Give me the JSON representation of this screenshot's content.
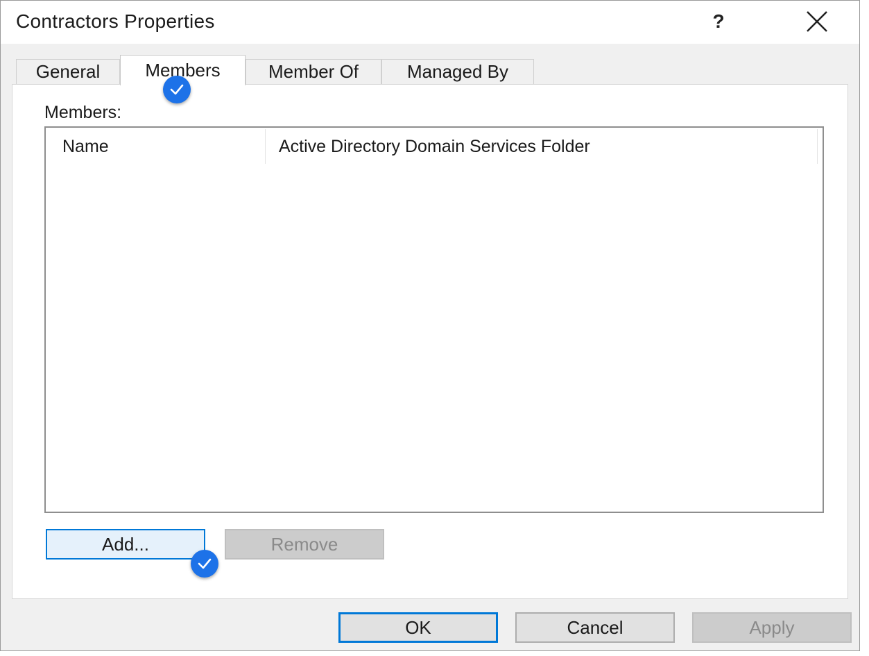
{
  "window": {
    "title": "Contractors Properties",
    "help_label": "?",
    "close_icon": "close-icon"
  },
  "tabs": [
    {
      "label": "General",
      "active": false
    },
    {
      "label": "Members",
      "active": true
    },
    {
      "label": "Member Of",
      "active": false
    },
    {
      "label": "Managed By",
      "active": false
    }
  ],
  "members": {
    "label": "Members:",
    "columns": [
      "Name",
      "Active Directory Domain Services Folder"
    ],
    "rows": []
  },
  "buttons": {
    "add": "Add...",
    "remove": "Remove",
    "ok": "OK",
    "cancel": "Cancel",
    "apply": "Apply"
  },
  "colors": {
    "accent": "#0078d7",
    "badge": "#1d72e8",
    "dialog_bg": "#f0f0f0"
  }
}
